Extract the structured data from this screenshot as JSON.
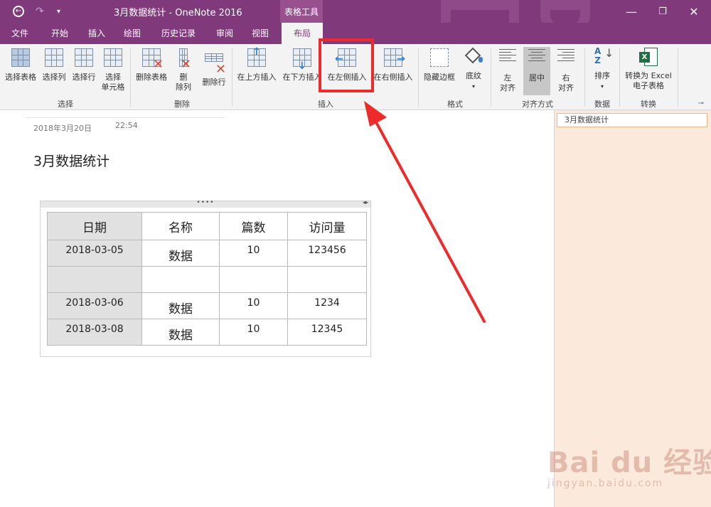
{
  "window": {
    "title": "3月数据统计 - OneNote 2016",
    "context_tab": "表格工具"
  },
  "tabs": [
    {
      "label": "文件"
    },
    {
      "label": "开始"
    },
    {
      "label": "插入"
    },
    {
      "label": "绘图"
    },
    {
      "label": "历史记录"
    },
    {
      "label": "审阅"
    },
    {
      "label": "视图"
    },
    {
      "label": "布局",
      "active": true
    }
  ],
  "ribbon": {
    "select": {
      "group": "选择",
      "table": "选择表格",
      "column": "选择列",
      "row": "选择行",
      "cell_line1": "选择",
      "cell_line2": "单元格"
    },
    "delete": {
      "group": "删除",
      "table": "删除表格",
      "col_line1": "删",
      "col_line2": "除列",
      "row": "删除行"
    },
    "insert": {
      "group": "插入",
      "above": "在上方插入",
      "below": "在下方插入",
      "left": "在左侧插入",
      "right": "在右侧插入"
    },
    "format": {
      "group": "格式",
      "hide_borders": "隐藏边框",
      "shading": "底纹"
    },
    "align": {
      "group": "对齐方式",
      "left_line1": "左",
      "left_line2": "对齐",
      "center": "居中",
      "right_line1": "右",
      "right_line2": "对齐"
    },
    "data": {
      "group": "数据",
      "sort": "排序"
    },
    "convert": {
      "group": "转换",
      "line1": "转换为 Excel",
      "line2": "电子表格"
    }
  },
  "page": {
    "date": "2018年3月20日",
    "time": "22:54",
    "title": "3月数据统计"
  },
  "table": {
    "headers": [
      "日期",
      "名称",
      "篇数",
      "访问量"
    ],
    "rows": [
      [
        "2018-03-05",
        "数据",
        "10",
        "123456"
      ],
      [
        "",
        "",
        "",
        ""
      ],
      [
        "2018-03-06",
        "数据",
        "10",
        "1234"
      ],
      [
        "2018-03-08",
        "数据",
        "10",
        "12345"
      ]
    ]
  },
  "pages_pane": {
    "items": [
      "3月数据统计"
    ]
  },
  "watermark": {
    "main": "Bai du 经验",
    "sub": "jingyan.baidu.com"
  },
  "colors": {
    "accent": "#80397b",
    "annotation": "#ee2a2a",
    "pane": "#fbe9dc"
  }
}
